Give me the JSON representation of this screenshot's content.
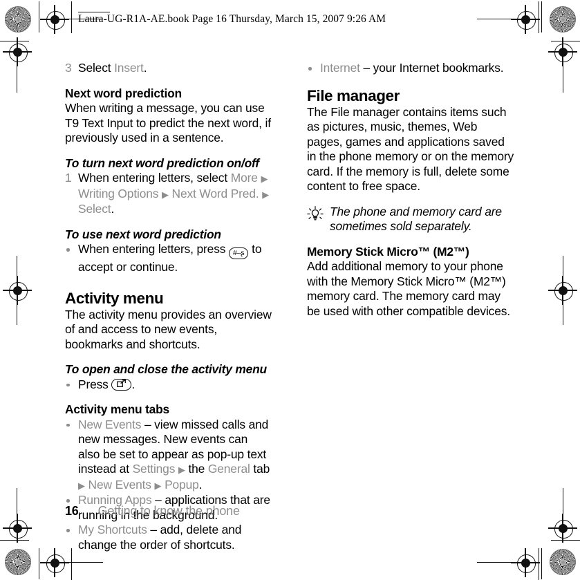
{
  "header": {
    "filename_line": "Laura-UG-R1A-AE.book  Page 16  Thursday, March 15, 2007  9:26 AM"
  },
  "footer": {
    "page_number": "16",
    "running_title": "Getting to know the phone"
  },
  "left_column": {
    "step3": {
      "number": "3",
      "text_before": "Select ",
      "ui_term": "Insert",
      "text_after": "."
    },
    "next_word_prediction": {
      "heading": "Next word prediction",
      "body": "When writing a message, you can use T9 Text Input to predict the next word, if previously used in a sentence."
    },
    "turn_on_off": {
      "heading": "To turn next word prediction on/off",
      "step_number": "1",
      "text_before": "When entering letters, select ",
      "ui_more": "More",
      "arrow1": "▶",
      "ui_writing_options": "Writing Options",
      "arrow2": "▶",
      "ui_next_word_pred": "Next Word Pred.",
      "arrow3": "▶",
      "ui_select": "Select",
      "text_after": "."
    },
    "use_prediction": {
      "heading": "To use next word prediction",
      "text_before": "When entering letters, press ",
      "key_label": "#–ʂ",
      "key_icon_name": "hash-key-icon",
      "text_after": " to accept or continue."
    },
    "activity_menu": {
      "heading": "Activity menu",
      "body": "The activity menu provides an overview of and access to new events, bookmarks and shortcuts."
    },
    "open_close": {
      "heading": "To open and close the activity menu",
      "text_before": "Press ",
      "key_icon_name": "activity-menu-key-icon",
      "text_after": "."
    },
    "tabs": {
      "heading": "Activity menu tabs",
      "items": [
        {
          "ui_term": "New Events",
          "text_1": " – view missed calls and new messages. New events can also be set to appear as pop-up text instead at ",
          "ui_settings": "Settings",
          "arrow1": "▶",
          "text_2": " the ",
          "ui_general": "General",
          "text_3": " tab ",
          "arrow2": "▶",
          "ui_new_events": "New Events",
          "arrow3": "▶",
          "ui_popup": "Popup",
          "text_4": "."
        },
        {
          "ui_term": "Running Apps",
          "text_1": " – applications that are running in the background."
        },
        {
          "ui_term": "My Shortcuts",
          "text_1": " – add, delete and change the order of shortcuts."
        }
      ]
    }
  },
  "right_column": {
    "internet_item": {
      "ui_term": "Internet",
      "text": " – your Internet bookmarks."
    },
    "file_manager": {
      "heading": "File manager",
      "body": "The File manager contains items such as pictures, music, themes, Web pages, games and applications saved in the phone memory or on the memory card. If the memory is full, delete some content to free space."
    },
    "tip": {
      "icon_name": "light-bulb-icon",
      "text": "The phone and memory card are sometimes sold separately."
    },
    "memory_stick": {
      "heading": "Memory Stick Micro™ (M2™)",
      "body": "Add additional memory to your phone with the Memory Stick Micro™ (M2™) memory card. The memory card may be used with other compatible devices."
    }
  },
  "colors": {
    "ui_term_gray": "#8d8d8d",
    "body_black": "#000000",
    "footer_gray": "#8d8d8d"
  }
}
